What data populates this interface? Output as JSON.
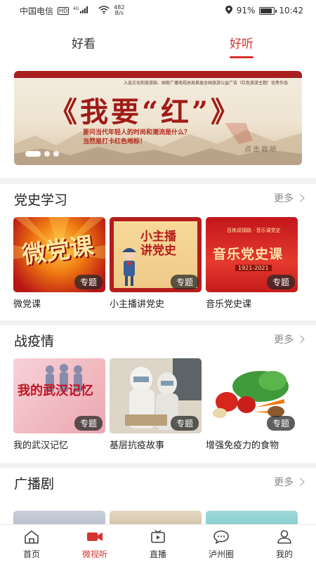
{
  "status_bar": {
    "carrier": "中国电信",
    "hd_badge": "HD",
    "signal_type": "4G",
    "net_speed_value": "482",
    "net_speed_unit": "B/s",
    "battery": "91%",
    "time": "10:42"
  },
  "top_tabs": [
    {
      "label": "好看",
      "active": false
    },
    {
      "label": "好听",
      "active": true
    }
  ],
  "banner": {
    "caption": "入选文化和旅游部、国家广播电视总局首届全国旅游公益广告（红色旅游主题）优秀作品",
    "title": "《我要“红”》",
    "subtitle_1": "要问当代年轻人的时尚和潮流是什么？",
    "subtitle_2": "当然是打卡红色地标！",
    "action": "点击收听",
    "slide_count": 3,
    "active_slide": 1
  },
  "sections": {
    "party": {
      "title": "党史学习",
      "more": "更多",
      "cards": [
        {
          "label": "微党课",
          "tag": "专题",
          "thumb_text": "微党课"
        },
        {
          "label": "小主播讲党史",
          "tag": "专题",
          "thumb_text_1": "小主播",
          "thumb_text_2": "讲党史"
        },
        {
          "label": "音乐党史课",
          "tag": "专题",
          "thumb_text": "音乐党史课",
          "thumb_small": "百炼成钢路 · 音乐课党史",
          "thumb_years": "1921-2021"
        }
      ]
    },
    "epidemic": {
      "title": "战疫情",
      "more": "更多",
      "cards": [
        {
          "label": "我的武汉记忆",
          "tag": "专题",
          "thumb_text": "我的武汉记忆"
        },
        {
          "label": "基层抗疫故事",
          "tag": "专题"
        },
        {
          "label": "增强免疫力的食物",
          "tag": "专题"
        }
      ]
    },
    "radio": {
      "title": "广播剧",
      "more": "更多"
    }
  },
  "bottom_nav": [
    {
      "label": "首页",
      "icon": "home-icon",
      "active": false
    },
    {
      "label": "微视听",
      "icon": "video-camera-icon",
      "active": true
    },
    {
      "label": "直播",
      "icon": "tv-icon",
      "active": false
    },
    {
      "label": "泸州圈",
      "icon": "chat-bubble-icon",
      "active": false
    },
    {
      "label": "我的",
      "icon": "user-icon",
      "active": false
    }
  ],
  "colors": {
    "accent": "#d8322e",
    "text": "#222222",
    "muted": "#888888"
  }
}
